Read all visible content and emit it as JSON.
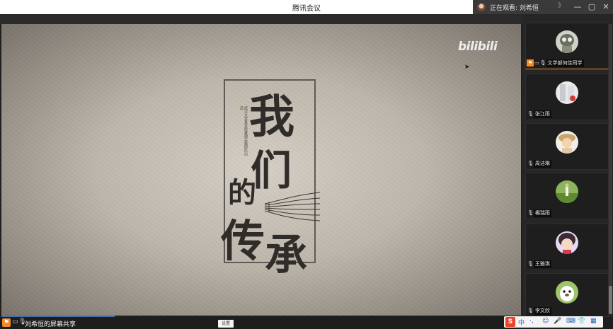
{
  "window": {
    "title": "腾讯会议",
    "watching_text": "正在观看: 刘希恒",
    "chevron": "⟩⟩",
    "controls": {
      "minimize": "—",
      "maximize": "▢",
      "close": "✕"
    }
  },
  "screen_share": {
    "watermark": "bilibili",
    "title_chars": [
      "我",
      "们",
      "的",
      "传",
      "承"
    ],
    "vertical_caption": "武汉大学某学院暑期实践团队出品"
  },
  "bottom_bar": {
    "share_label": "刘希恒的屏幕共享",
    "chip_text": "设置"
  },
  "ime": {
    "logo": "S",
    "language": "中",
    "tools": [
      "·,",
      "☺",
      "🎤",
      "⌨",
      "👕",
      "▦"
    ]
  },
  "participants": [
    {
      "name": "文学部何佳同学",
      "avatar": "avatar-1",
      "is_host": true
    },
    {
      "name": "张江雨",
      "avatar": "avatar-2",
      "is_host": false
    },
    {
      "name": "周洁琳",
      "avatar": "avatar-3",
      "is_host": false
    },
    {
      "name": "楊瑞雨",
      "avatar": "avatar-4",
      "is_host": false
    },
    {
      "name": "王雅琪",
      "avatar": "avatar-5",
      "is_host": false
    },
    {
      "name": "李文欣",
      "avatar": "avatar-6",
      "is_host": false
    }
  ]
}
